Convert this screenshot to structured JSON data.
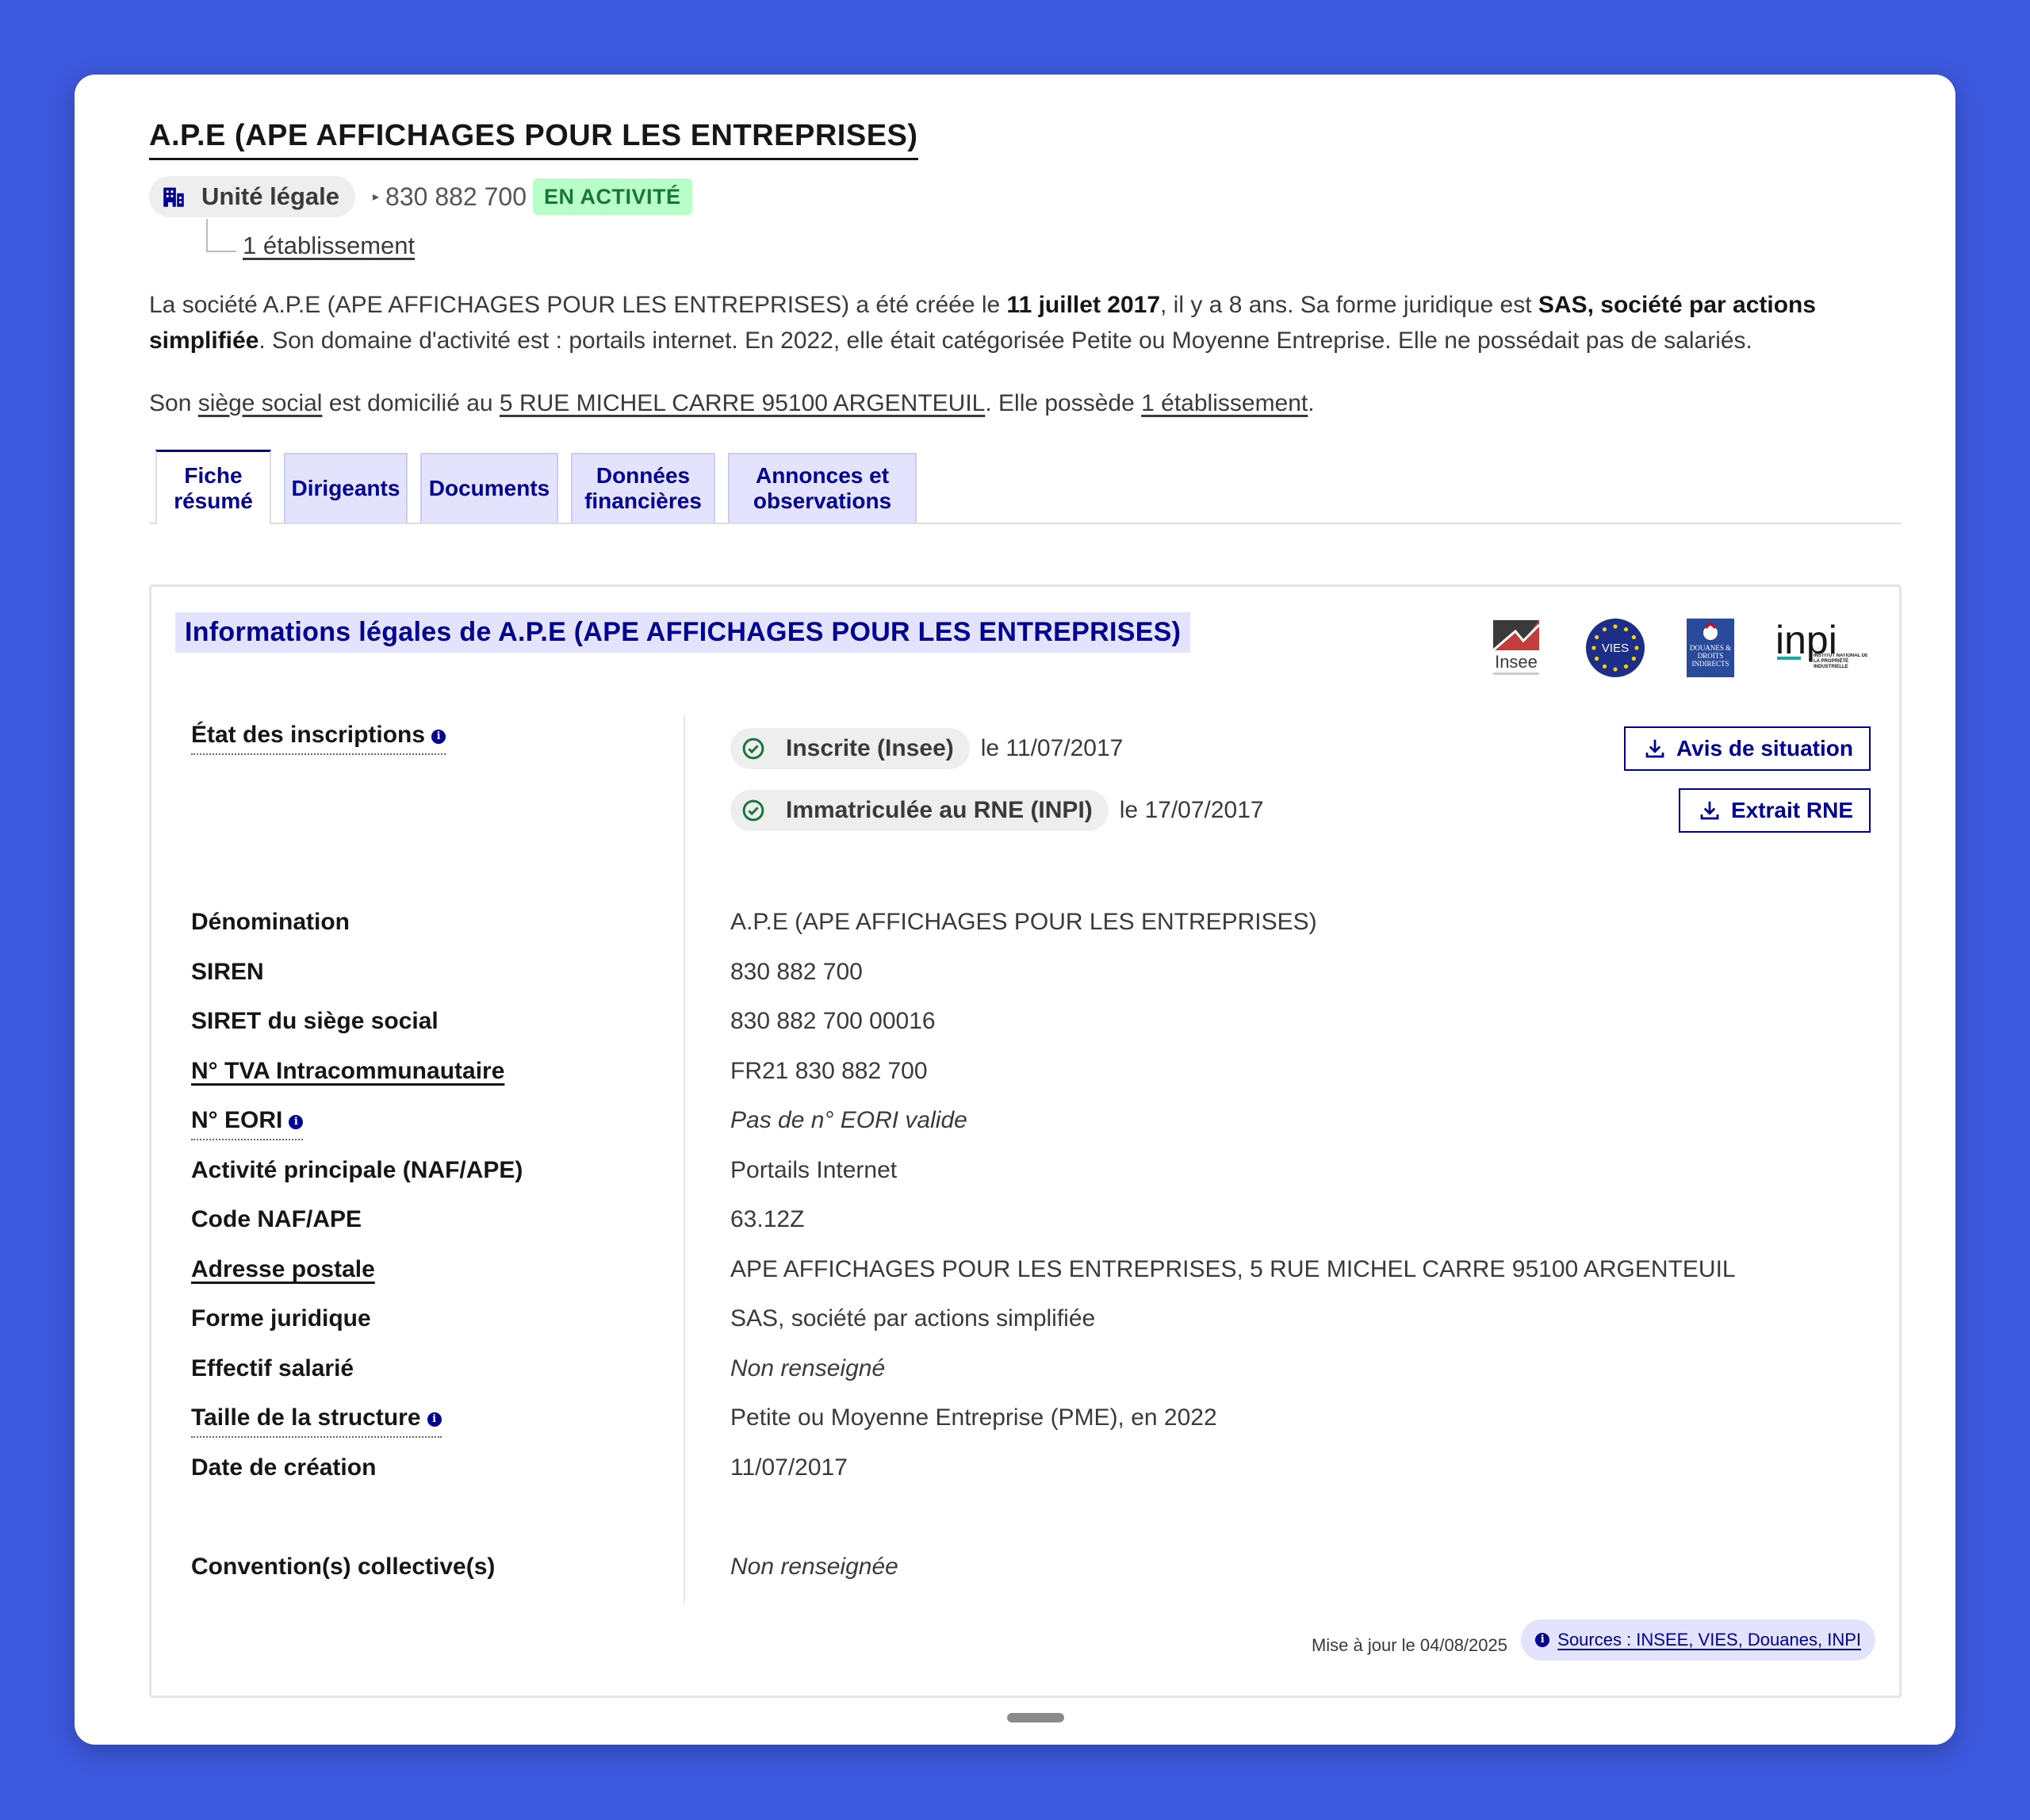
{
  "header": {
    "title": "A.P.E (APE AFFICHAGES POUR LES ENTREPRISES)",
    "unit_label": "Unité légale",
    "siren": "830 882 700",
    "status": "EN ACTIVITÉ",
    "etablissements_link": "1 établissement"
  },
  "description": {
    "p1_a": "La société A.P.E (APE AFFICHAGES POUR LES ENTREPRISES) a été créée le ",
    "p1_date": "11 juillet 2017",
    "p1_b": ", il y a 8 ans. Sa forme juridique est ",
    "p1_form": "SAS, société par actions simplifiée",
    "p1_c": ". Son domaine d'activité est : portails internet. En 2022, elle était catégorisée Petite ou Moyenne Entreprise. Elle ne possédait pas de salariés.",
    "p2_a": "Son ",
    "p2_siege": "siège social",
    "p2_b": " est domicilié au ",
    "p2_address": "5 RUE MICHEL CARRE 95100 ARGENTEUIL",
    "p2_c": ". Elle possède ",
    "p2_etab": "1 établissement",
    "p2_d": "."
  },
  "tabs": [
    {
      "label_1": "Fiche",
      "label_2": "résumé"
    },
    {
      "label_1": "Dirigeants",
      "label_2": ""
    },
    {
      "label_1": "Documents",
      "label_2": ""
    },
    {
      "label_1": "Données",
      "label_2": "financières"
    },
    {
      "label_1": "Annonces et",
      "label_2": "observations"
    }
  ],
  "panel": {
    "title": "Informations légales de A.P.E (APE AFFICHAGES POUR LES ENTREPRISES)",
    "logos": {
      "insee": "Insee",
      "vies": "VIES",
      "douanes": "DOUANES & DROITS INDIRECTS",
      "inpi": "inpi",
      "inpi_sub": "INSTITUT NATIONAL DE LA PROPRIÉTÉ INDUSTRIELLE"
    },
    "inscriptions_label": "État des inscriptions",
    "inscription_insee": "Inscrite (Insee)",
    "inscription_insee_date": "le 11/07/2017",
    "inscription_rne": "Immatriculée au RNE (INPI)",
    "inscription_rne_date": "le 17/07/2017",
    "btn_avis": "Avis de situation",
    "btn_extrait": "Extrait RNE",
    "rows": [
      {
        "label": "Dénomination",
        "value": "A.P.E (APE AFFICHAGES POUR LES ENTREPRISES)"
      },
      {
        "label": "SIREN",
        "value": "830 882 700"
      },
      {
        "label": "SIRET du siège social",
        "value": "830 882 700 00016"
      },
      {
        "label": "N° TVA Intracommunautaire",
        "value": "FR21 830 882 700"
      },
      {
        "label": "N° EORI",
        "value": "Pas de n° EORI valide"
      },
      {
        "label": "Activité principale (NAF/APE)",
        "value": "Portails Internet"
      },
      {
        "label": "Code NAF/APE",
        "value": "63.12Z"
      },
      {
        "label": "Adresse postale",
        "value": "APE AFFICHAGES POUR LES ENTREPRISES, 5 RUE MICHEL CARRE 95100 ARGENTEUIL"
      },
      {
        "label": "Forme juridique",
        "value": "SAS, société par actions simplifiée"
      },
      {
        "label": "Effectif salarié",
        "value": "Non renseigné"
      },
      {
        "label": "Taille de la structure",
        "value": "Petite ou Moyenne Entreprise (PME), en 2022"
      },
      {
        "label": "Date de création",
        "value": "11/07/2017"
      },
      {
        "label": "Convention(s) collective(s)",
        "value": "Non renseignée"
      }
    ],
    "updated": "Mise à jour le 04/08/2025",
    "sources": "Sources : INSEE, VIES, Douanes, INPI"
  },
  "colors": {
    "background": "#3d59de",
    "accent": "#000091",
    "active_green": "#18753c",
    "active_bg": "#b8fec9"
  }
}
